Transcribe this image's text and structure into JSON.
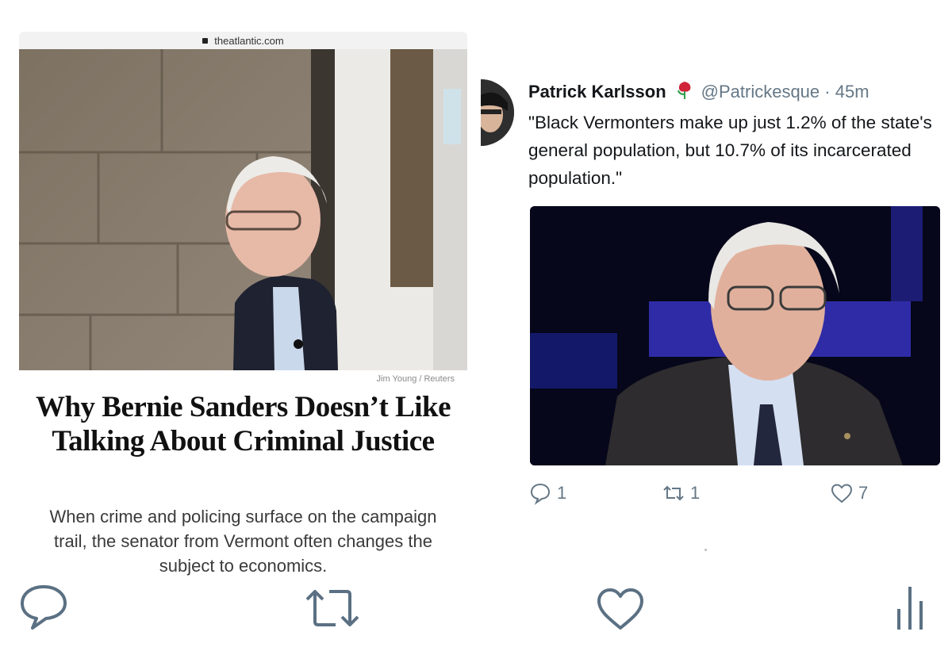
{
  "article": {
    "domain": "theatlantic.com",
    "photo_credit": "Jim Young / Reuters",
    "headline": "Why Bernie Sanders Doesn’t Like Talking About Criminal Justice",
    "dek": "When crime and policing surface on the campaign trail, the senator from Vermont often changes the subject to economics."
  },
  "tweet": {
    "name": "Patrick Karlsson",
    "handle": "@Patrickesque",
    "separator": "·",
    "time": "45m",
    "text": "\"Black Vermonters make up just 1.2% of the state's general population, but 10.7% of its incarcerated population.\"",
    "reply_count": "1",
    "retweet_count": "1",
    "like_count": "7"
  },
  "colors": {
    "tweet_secondary": "#657786",
    "icon_gray": "#657786",
    "toolbar_icon": "#5b7083"
  },
  "icons": {
    "reply": "speech-bubble-icon",
    "retweet": "retweet-icon",
    "like": "heart-icon",
    "stats": "bar-chart-icon",
    "rose": "rose-emoji-icon"
  }
}
